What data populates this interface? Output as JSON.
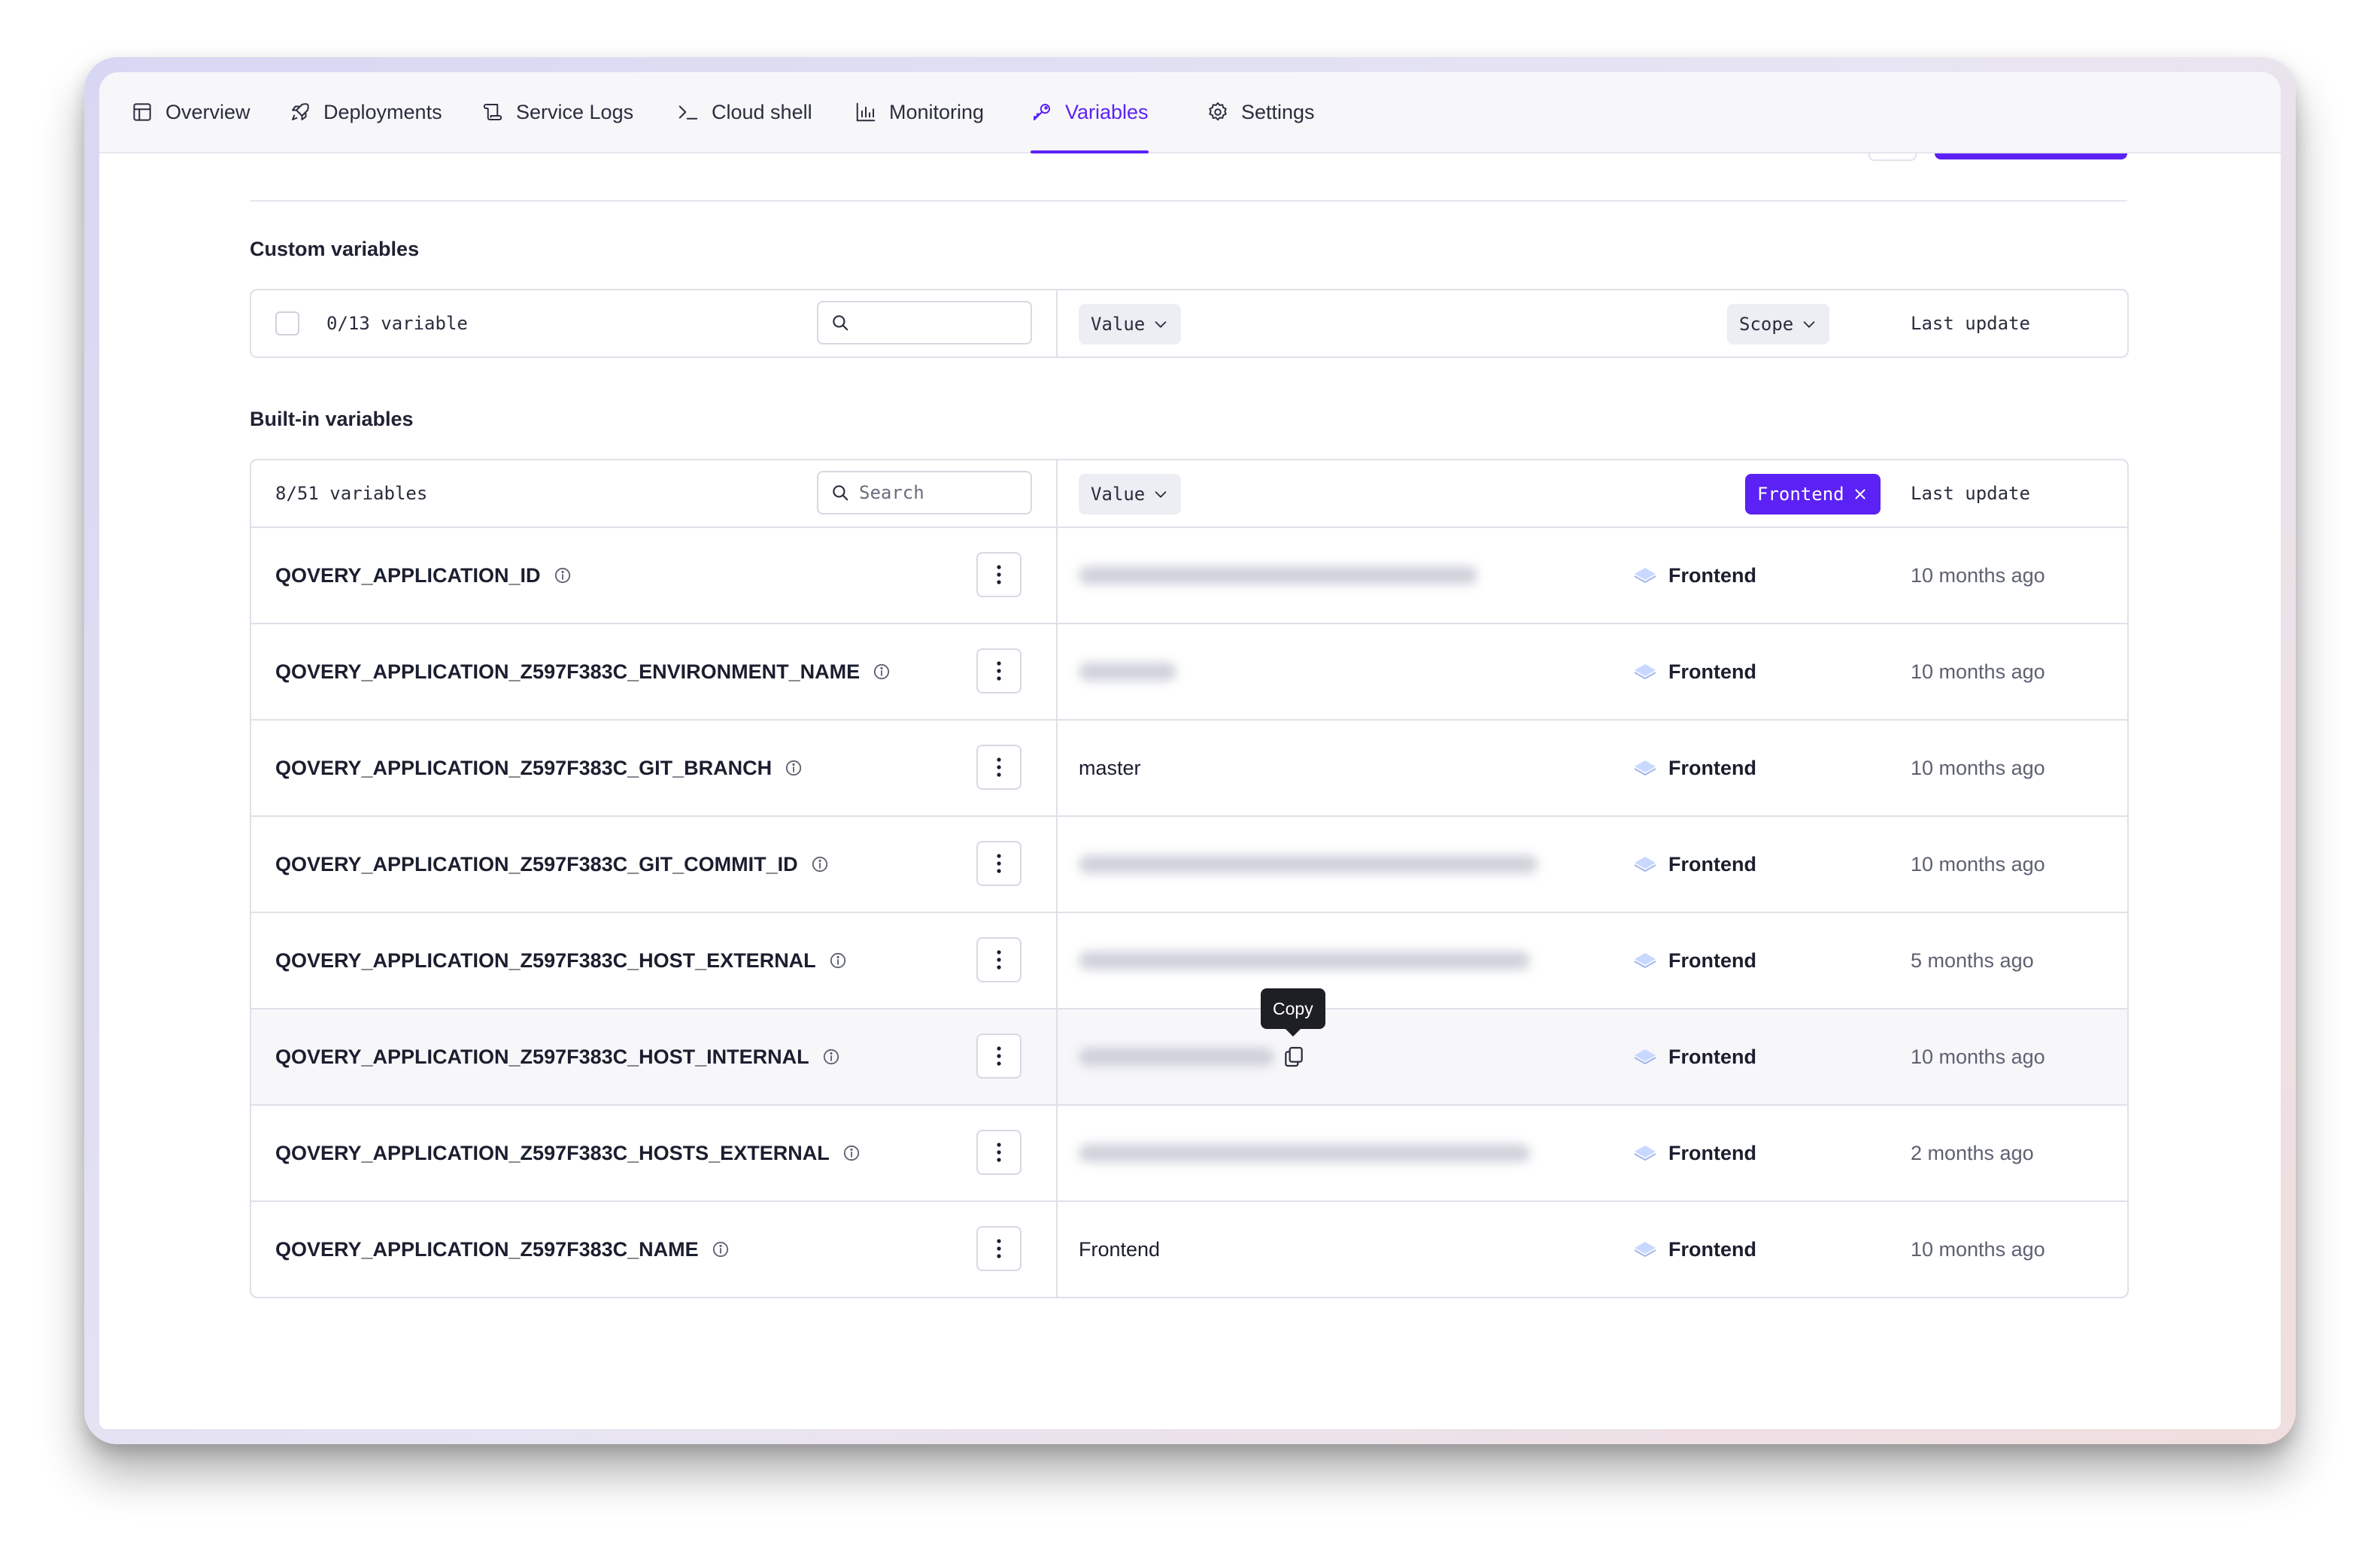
{
  "tabs": [
    {
      "label": "Overview",
      "icon": "layout-icon",
      "active": false
    },
    {
      "label": "Deployments",
      "icon": "rocket-icon",
      "active": false
    },
    {
      "label": "Service Logs",
      "icon": "logs-icon",
      "active": false
    },
    {
      "label": "Cloud shell",
      "icon": "terminal-icon",
      "active": false
    },
    {
      "label": "Monitoring",
      "icon": "chart-icon",
      "active": false
    },
    {
      "label": "Variables",
      "icon": "key-icon",
      "active": true
    },
    {
      "label": "Settings",
      "icon": "gear-icon",
      "active": false
    }
  ],
  "accent_color": "#5b21f5",
  "custom": {
    "title": "Custom variables",
    "count": "0/13 variable",
    "search_value": "",
    "search_placeholder": "",
    "value_label": "Value",
    "scope_label": "Scope",
    "last_update_label": "Last update"
  },
  "builtin": {
    "title": "Built-in variables",
    "count": "8/51 variables",
    "search_placeholder": "Search",
    "value_label": "Value",
    "filter_label": "Frontend",
    "last_update_label": "Last update",
    "tooltip": "Copy",
    "rows": [
      {
        "name": "QOVERY_APPLICATION_ID",
        "value": "",
        "scope": "Frontend",
        "updated": "10 months ago"
      },
      {
        "name": "QOVERY_APPLICATION_Z597F383C_ENVIRONMENT_NAME",
        "value": "",
        "scope": "Frontend",
        "updated": "10 months ago"
      },
      {
        "name": "QOVERY_APPLICATION_Z597F383C_GIT_BRANCH",
        "value": "master",
        "scope": "Frontend",
        "updated": "10 months ago"
      },
      {
        "name": "QOVERY_APPLICATION_Z597F383C_GIT_COMMIT_ID",
        "value": "",
        "scope": "Frontend",
        "updated": "10 months ago"
      },
      {
        "name": "QOVERY_APPLICATION_Z597F383C_HOST_EXTERNAL",
        "value": "",
        "scope": "Frontend",
        "updated": "5 months ago"
      },
      {
        "name": "QOVERY_APPLICATION_Z597F383C_HOST_INTERNAL",
        "value": "",
        "scope": "Frontend",
        "updated": "10 months ago"
      },
      {
        "name": "QOVERY_APPLICATION_Z597F383C_HOSTS_EXTERNAL",
        "value": "",
        "scope": "Frontend",
        "updated": "2 months ago"
      },
      {
        "name": "QOVERY_APPLICATION_Z597F383C_NAME",
        "value": "Frontend",
        "scope": "Frontend",
        "updated": "10 months ago"
      }
    ]
  }
}
